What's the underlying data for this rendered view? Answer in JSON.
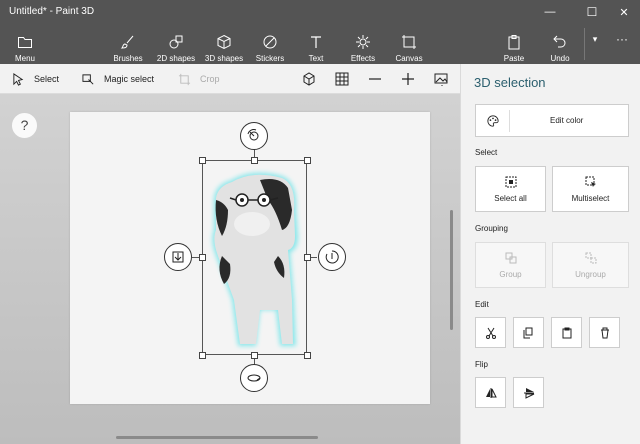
{
  "window": {
    "title": "Untitled* - Paint 3D",
    "minimize_glyph": "—",
    "maximize_glyph": "☐",
    "close_glyph": "✕"
  },
  "ribbon": {
    "menu_label": "Menu",
    "tools": [
      {
        "label": "Brushes",
        "icon": "brush-icon"
      },
      {
        "label": "2D shapes",
        "icon": "2d-shapes-icon"
      },
      {
        "label": "3D shapes",
        "icon": "3d-shapes-icon"
      },
      {
        "label": "Stickers",
        "icon": "stickers-icon"
      },
      {
        "label": "Text",
        "icon": "text-icon"
      },
      {
        "label": "Effects",
        "icon": "effects-icon"
      },
      {
        "label": "Canvas",
        "icon": "canvas-icon"
      }
    ],
    "paste_label": "Paste",
    "undo_label": "Undo",
    "expand_glyph": "▾",
    "more_glyph": "···"
  },
  "toolbar": {
    "select_label": "Select",
    "magic_select_label": "Magic select",
    "crop_label": "Crop"
  },
  "canvas": {
    "help_glyph": "?",
    "selected_object": "3D dog model"
  },
  "panel": {
    "title": "3D selection",
    "edit_color_label": "Edit color",
    "select_section": "Select",
    "select_all_label": "Select all",
    "multiselect_label": "Multiselect",
    "grouping_section": "Grouping",
    "group_label": "Group",
    "ungroup_label": "Ungroup",
    "edit_section": "Edit",
    "flip_section": "Flip"
  },
  "colors": {
    "titlebar": "#545454",
    "panel_title": "#2b5f6e",
    "selection_glow": "#7fe6ea"
  }
}
